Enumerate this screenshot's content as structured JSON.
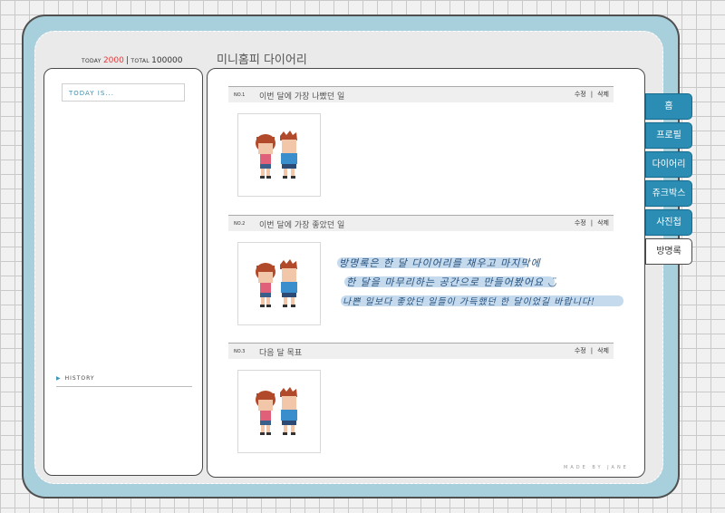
{
  "counter": {
    "today_label": "TODAY",
    "today_value": "2000",
    "separator": "|",
    "total_label": "TOTAL",
    "total_value": "100000"
  },
  "page_title": "미니홈피 다이어리",
  "left_panel": {
    "today_is": "TODAY IS...",
    "history": "HISTORY"
  },
  "entries": [
    {
      "no": "NO.1",
      "title": "이번 달에 가장 나빴던 일",
      "edit": "수정",
      "delete": "삭제"
    },
    {
      "no": "NO.2",
      "title": "이번 달에 가장 좋았던 일",
      "edit": "수정",
      "delete": "삭제"
    },
    {
      "no": "NO.3",
      "title": "다음 달 목표",
      "edit": "수정",
      "delete": "삭제"
    }
  ],
  "handwriting": [
    "방명록은 한 달 다이어리를 채우고 마지막에",
    "한 달을 마무리하는 공간으로 만들어봤어요 ◡̈",
    "나쁜 일보다 좋았던 일들이 가득했던 한 달이었길 바랍니다!"
  ],
  "tabs": [
    "홈",
    "프로필",
    "다이어리",
    "쥬크박스",
    "사진첩",
    "방명록"
  ],
  "active_tab": "방명록",
  "colors": {
    "accent": "#2b8db4",
    "frame_blue": "#a8d0dc",
    "today_red": "#e53a3a",
    "highlight": "#bcd3ea"
  },
  "footer": "MADE BY JANE"
}
